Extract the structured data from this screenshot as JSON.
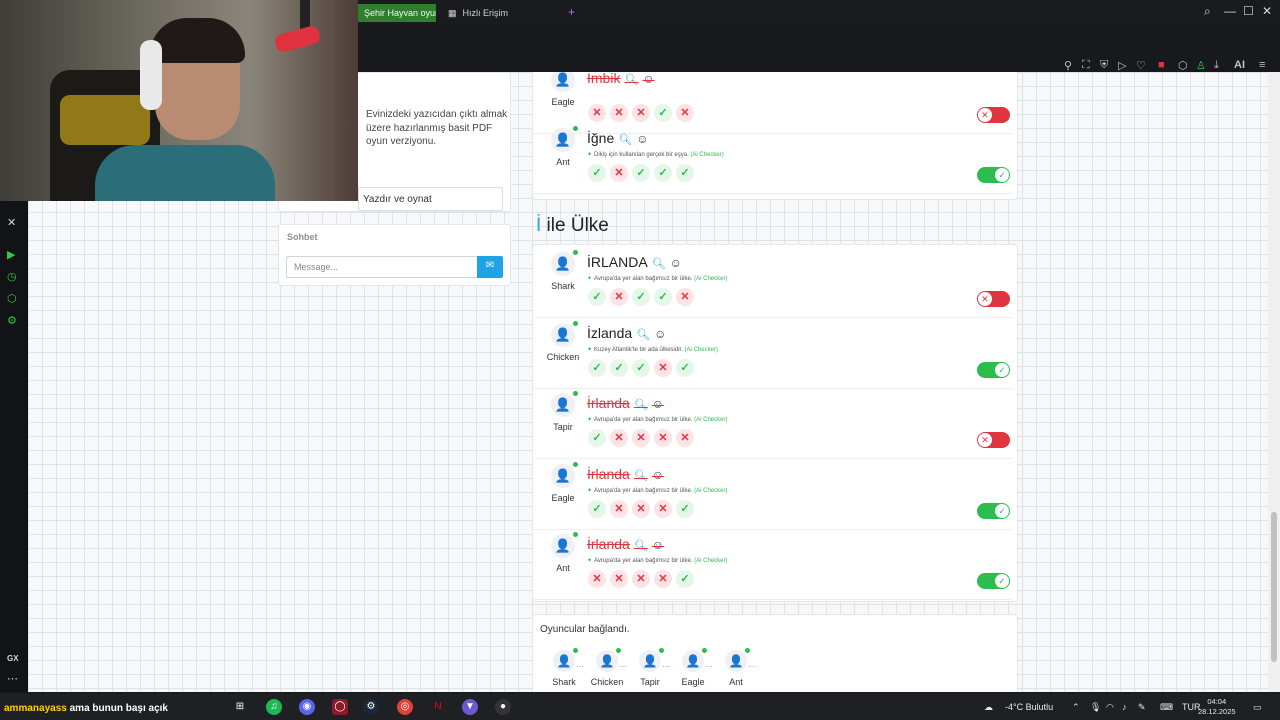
{
  "browser": {
    "tabs": [
      {
        "label": "Şehir Hayvan oyunu"
      },
      {
        "label": "Hızlı Erişim"
      }
    ],
    "new_tab": "+",
    "ai_label": "AI"
  },
  "left_panel": {
    "print_text": "Evinizdeki yazıcıdan çıktı almak üzere hazırlanmış basit PDF oyun verziyonu.",
    "print_button": "Yazdır ve oynat",
    "chat_title": "Sohbet",
    "chat_placeholder": "Message..."
  },
  "top_answers": [
    {
      "player": "Eagle",
      "word": "İmbik",
      "rejected": true,
      "hint": "",
      "votes": [
        "no",
        "no",
        "no",
        "yes",
        "no"
      ],
      "accepted": false
    },
    {
      "player": "Ant",
      "word": "İğne",
      "rejected": false,
      "hint": "Dikiş için kullanılan gerçek bir eşya.",
      "ai": "(Ai Checker)",
      "votes": [
        "yes",
        "no",
        "yes",
        "yes",
        "yes"
      ],
      "accepted": true
    }
  ],
  "category": {
    "letter": "İ",
    "name": " ile Ülke"
  },
  "answers": [
    {
      "player": "Shark",
      "word": "İRLANDA",
      "rejected": false,
      "hint": "Avrupa'da yer alan bağımsız bir ülke.",
      "ai": "(Ai Checker)",
      "votes": [
        "yes",
        "no",
        "yes",
        "yes",
        "no"
      ],
      "accepted": false
    },
    {
      "player": "Chicken",
      "word": "İzlanda",
      "rejected": false,
      "hint": "Kuzey Atlantik'te bir ada ülkesidir.",
      "ai": "(Ai Checker)",
      "votes": [
        "yes",
        "yes",
        "yes",
        "no",
        "yes"
      ],
      "accepted": true
    },
    {
      "player": "Tapir",
      "word": "İrlanda",
      "rejected": true,
      "hint": "Avrupa'da yer alan bağımsız bir ülke.",
      "ai": "(Ai Checker)",
      "votes": [
        "yes",
        "no",
        "no",
        "no",
        "no"
      ],
      "accepted": false
    },
    {
      "player": "Eagle",
      "word": "İrlanda",
      "rejected": true,
      "hint": "Avrupa'da yer alan bağımsız bir ülke.",
      "ai": "(Ai Checker)",
      "votes": [
        "yes",
        "no",
        "no",
        "no",
        "yes"
      ],
      "accepted": true
    },
    {
      "player": "Ant",
      "word": "İrlanda",
      "rejected": true,
      "hint": "Avrupa'da yer alan bağımsız bir ülke.",
      "ai": "(Ai Checker)",
      "votes": [
        "no",
        "no",
        "no",
        "no",
        "yes"
      ],
      "accepted": true
    }
  ],
  "players_connected": {
    "title": "Oyuncular bağlandı.",
    "players": [
      "Shark",
      "Chicken",
      "Tapir",
      "Eagle",
      "Ant"
    ]
  },
  "taskbar": {
    "ticker_user": "ammanayass",
    "ticker_text": "ama bunun başı açık",
    "weather": "-4°C  Bulutlu",
    "lang": "TUR",
    "time": "04:04",
    "date": "28.12.2025"
  },
  "colors": {
    "accent": "#1fa2e6",
    "ok": "#2bbd4e",
    "bad": "#e0353f",
    "tab_active": "#2f7d2f"
  }
}
